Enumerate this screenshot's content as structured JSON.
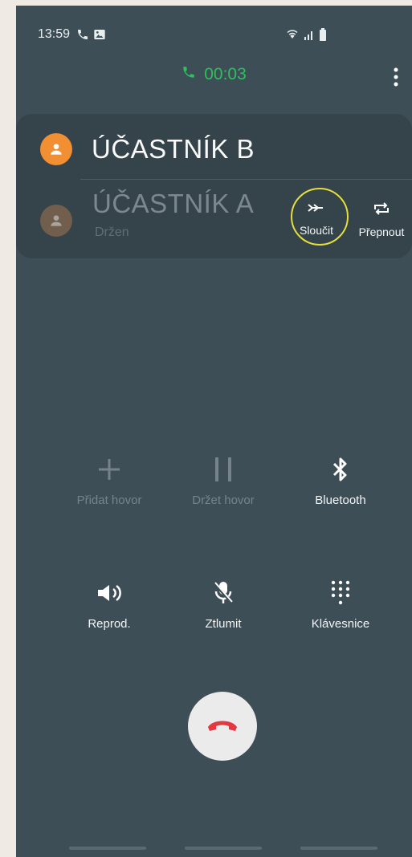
{
  "status_bar": {
    "time": "13:59",
    "left_icons": [
      "phone-call-icon",
      "image-notification-icon"
    ],
    "right_icons": [
      "wifi-icon",
      "signal-icon",
      "battery-icon"
    ]
  },
  "call": {
    "duration": "00:03",
    "duration_color": "#2bc15b"
  },
  "menu": {
    "icon": "more-vert-icon"
  },
  "participants": {
    "active": {
      "name": "ÚČASTNÍK B",
      "avatar_color": "#f18f32"
    },
    "held": {
      "name": "ÚČASTNÍK A",
      "status": "Držen",
      "avatar_color": "#86684d"
    },
    "actions": {
      "merge_label": "Sloučit",
      "swap_label": "Přepnout",
      "highlight_color": "#e4df3a"
    }
  },
  "controls": {
    "add_call": "Přidat hovor",
    "hold_call": "Držet hovor",
    "bluetooth": "Bluetooth",
    "speaker": "Reprod.",
    "mute": "Ztlumit",
    "keypad": "Klávesnice"
  },
  "end_call": {
    "icon": "end-call-icon",
    "color": "#e5373f"
  },
  "colors": {
    "background": "#3e4e57",
    "card": "#35434b"
  }
}
